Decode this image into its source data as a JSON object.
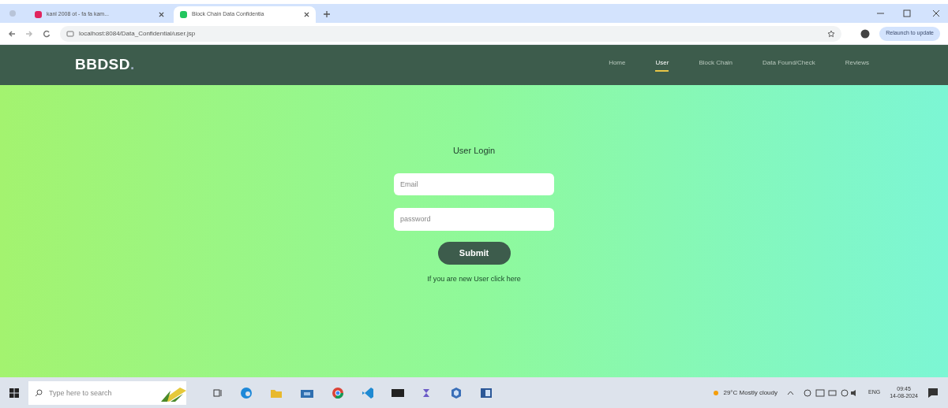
{
  "browser": {
    "tabs": [
      {
        "title": "kanl 2008 ot - fa fa kam...",
        "selected": false,
        "color": "#e0245e"
      },
      {
        "title": "Block Chain Data Confidentia",
        "selected": true,
        "color": "#22c55e"
      }
    ],
    "url": "localhost:8084/Data_Confidential/user.jsp",
    "update_button": "Relaunch to update"
  },
  "navbar": {
    "brand": "BBDSD",
    "brand_dot": ".",
    "links": [
      {
        "label": "Home",
        "selected": false
      },
      {
        "label": "User",
        "selected": true
      },
      {
        "label": "Block Chain",
        "selected": false
      },
      {
        "label": "Data Found/Check",
        "selected": false
      },
      {
        "label": "Reviews",
        "selected": false
      }
    ]
  },
  "login": {
    "title": "User Login",
    "email": {
      "placeholder": "Email"
    },
    "password": {
      "placeholder": "password"
    },
    "submit": "Submit",
    "register_link": "If you are new User click here"
  },
  "taskbar": {
    "search": {
      "placeholder": "Type here to search"
    },
    "weather": "29°C  Mostly cloudy",
    "language": "ENG",
    "time": "09:45",
    "date": "14-08-2024"
  }
}
